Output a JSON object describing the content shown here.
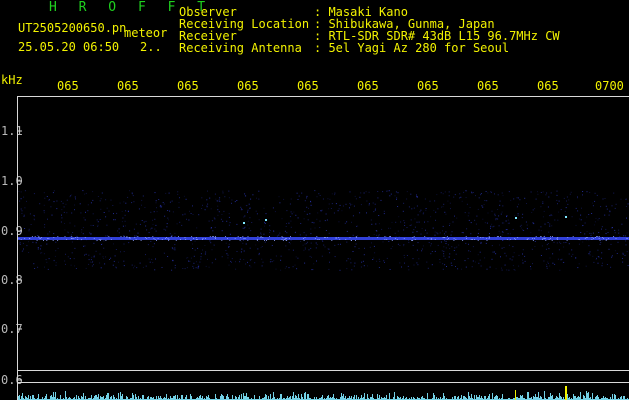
{
  "header": {
    "program_name": "H R O F F T",
    "file_name": "UT2505200650.pn",
    "mode_label": "meteor",
    "date_time": "25.05.20 06:50",
    "counter": "2..",
    "info_labels": [
      "Observer",
      "Receiving Location",
      "Receiver",
      "Receiving Antenna"
    ],
    "info_values": [
      ": Masaki Kano",
      ": Shibukawa, Gunma, Japan",
      ": RTL-SDR SDR# 43dB L15 96.7MHz CW",
      ": 5el Yagi Az 280 for Seoul"
    ]
  },
  "axes": {
    "y_unit": "kHz",
    "y_ticks": [
      "1.1",
      "1.0",
      "0.9",
      "0.8",
      "0.7",
      "0.6"
    ],
    "time_labels": [
      "065",
      "065",
      "065",
      "065",
      "065",
      "065",
      "065",
      "065",
      "065",
      "0700"
    ]
  },
  "colors": {
    "text": "#f2f200",
    "program": "#1fd11f",
    "signal": "#3a4bff",
    "noise": "#7fe8ff",
    "grid": "#d8d8d8"
  }
}
